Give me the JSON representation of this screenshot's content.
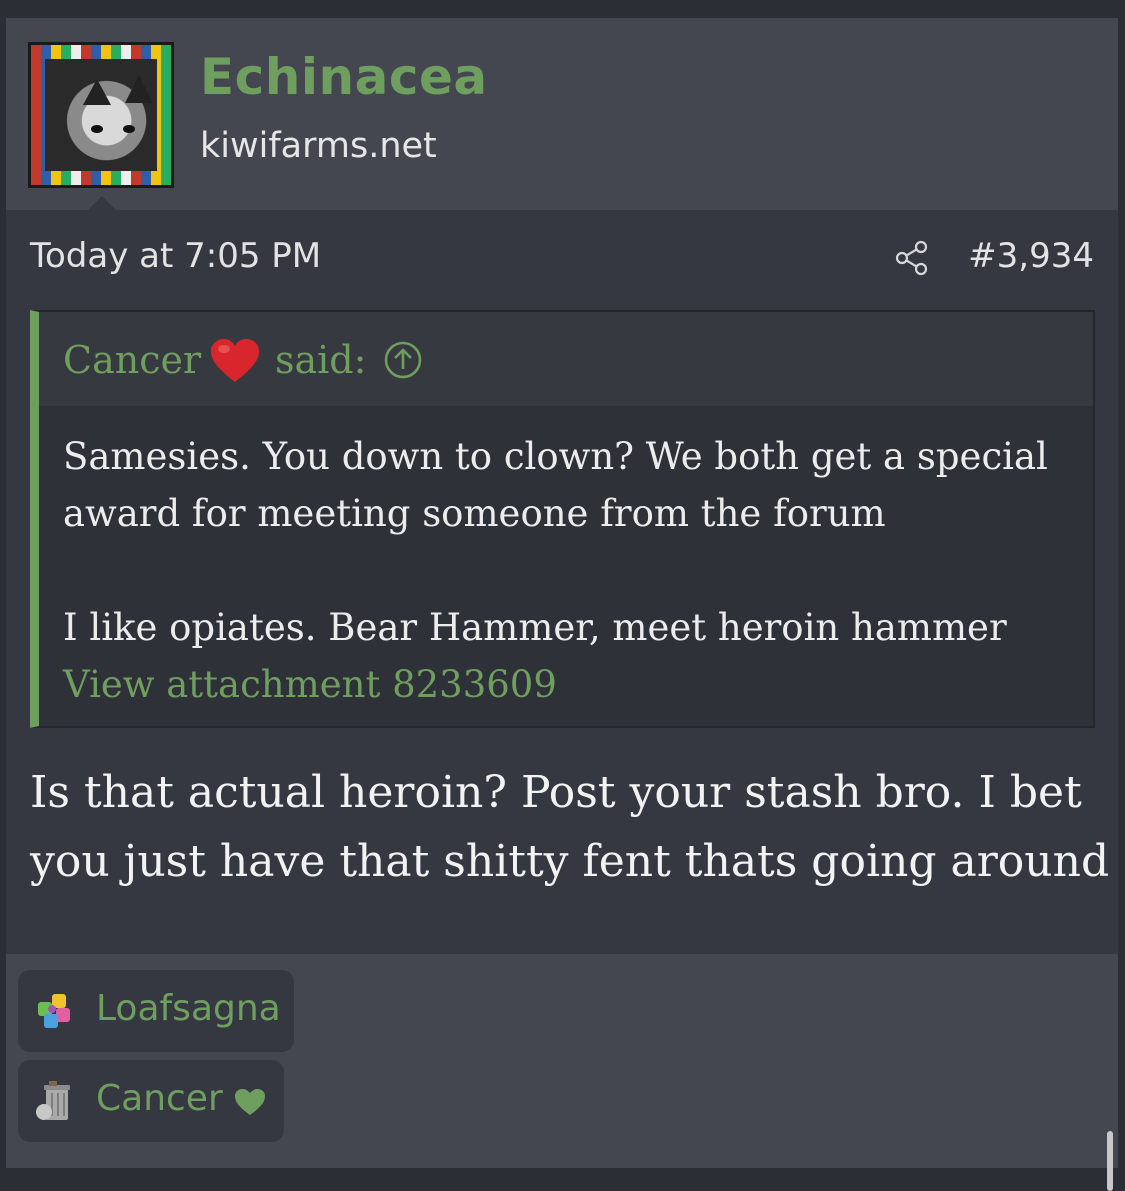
{
  "user": {
    "name": "Echinacea",
    "title": "kiwifarms.net",
    "avatar_icon": "cat-avatar-icon"
  },
  "post": {
    "date": "Today at 7:05 PM",
    "number": "#3,934",
    "share_icon": "share-icon"
  },
  "quote": {
    "author": "Cancer",
    "heart_icon": "red-heart-icon",
    "said": "said:",
    "jump_icon": "arrow-up-circle-icon",
    "lines": [
      "Samesies. You down to clown? We both get a special award for meeting someone from the forum",
      "I like opiates. Bear Hammer, meet heroin hammer"
    ],
    "attachment_link": "View attachment 8233609"
  },
  "reply": {
    "text": "Is that actual heroin? Post your stash bro. I bet you just have that shitty fent thats going around"
  },
  "reactions": [
    {
      "user": "Loafsagna",
      "icon": "puzzle-piece-icon"
    },
    {
      "user": "Cancer",
      "icon": "trash-can-icon",
      "badge_icon": "green-heart-icon"
    }
  ],
  "colors": {
    "accent_green": "#6f9f5f",
    "header_bg": "#44474f",
    "post_bg": "#353841",
    "quote_bg": "#2f3138",
    "heart_red": "#d9262c"
  }
}
